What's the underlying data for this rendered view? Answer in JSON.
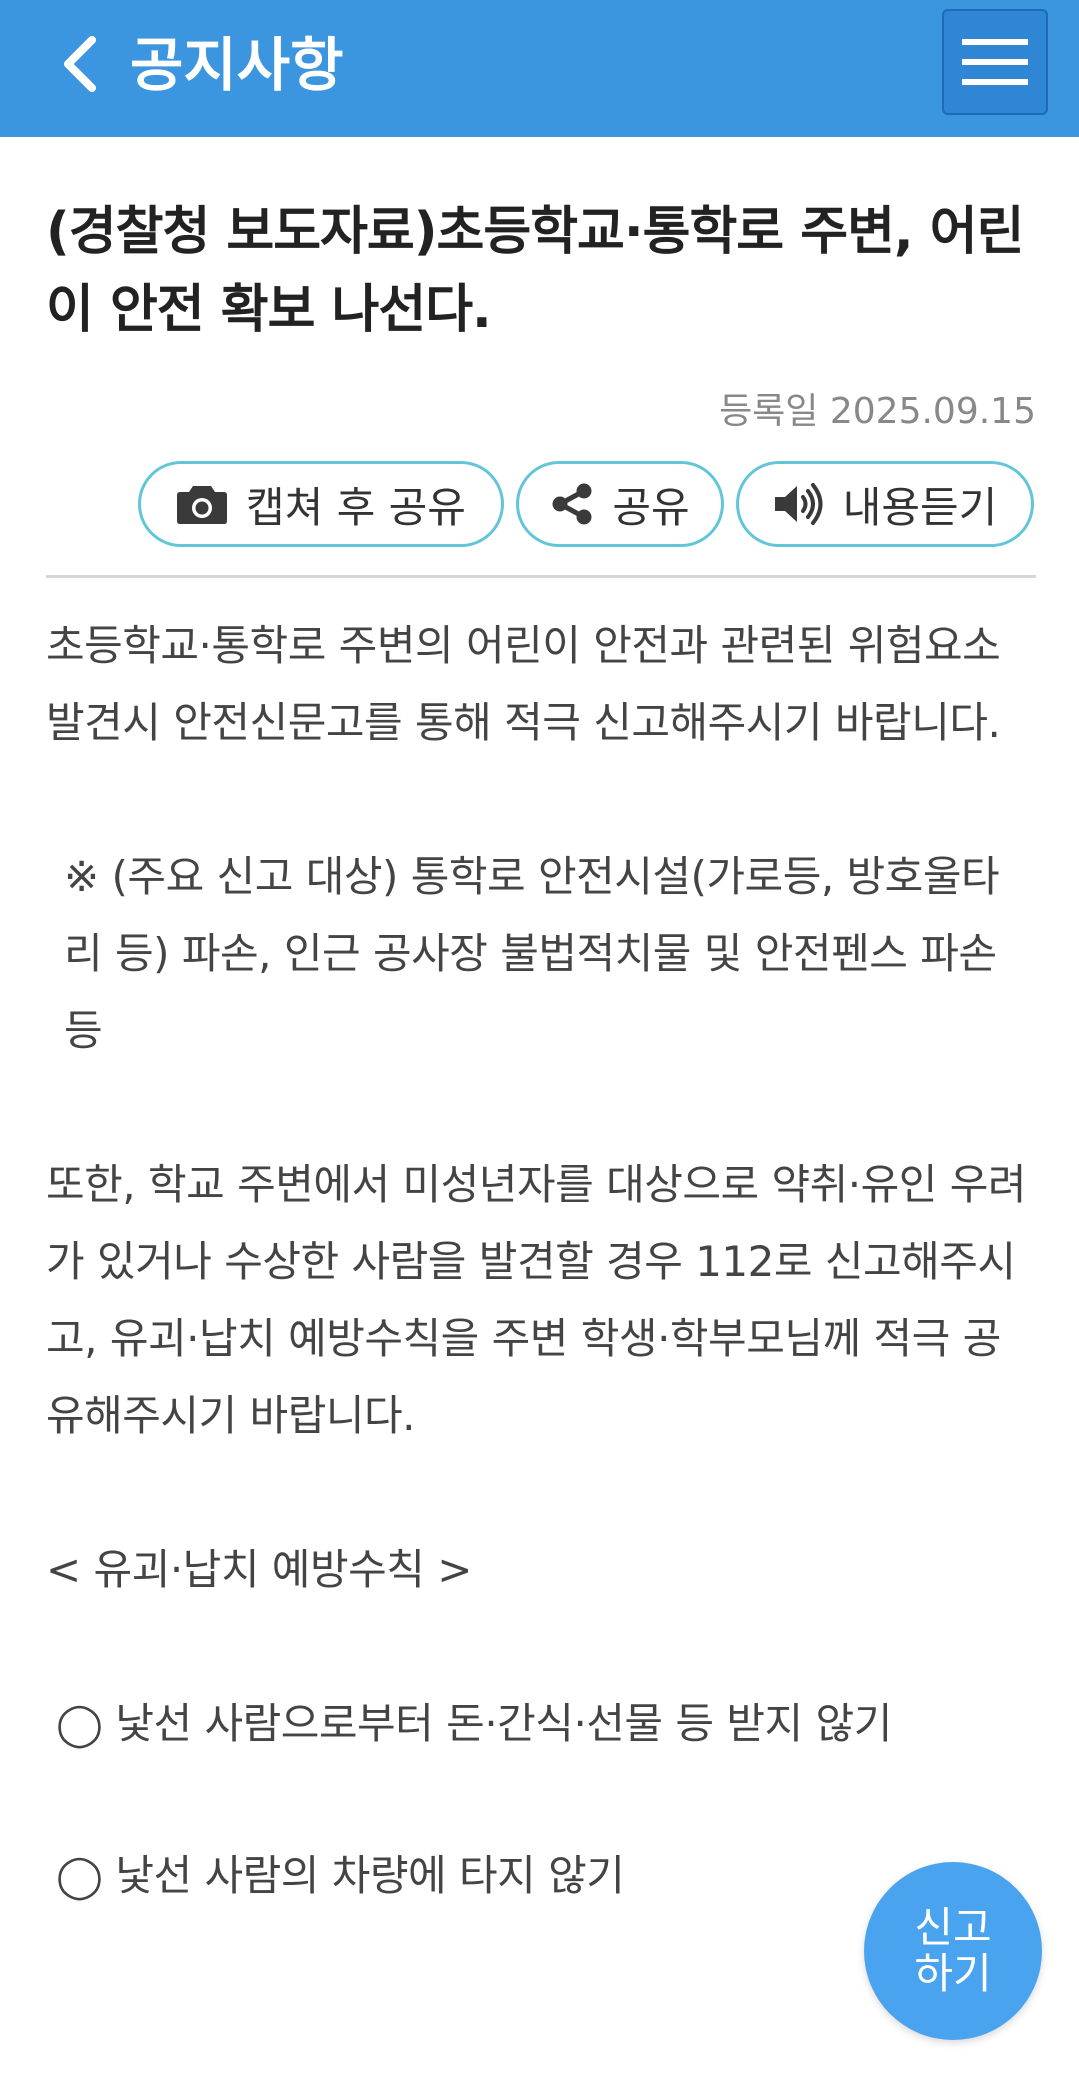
{
  "colors": {
    "primary": "#3b95df",
    "accent_outline": "#63c5d9",
    "fab": "#4aa3ee"
  },
  "header": {
    "title": "공지사항",
    "back_icon": "chevron-left-icon",
    "menu_icon": "hamburger-menu-icon"
  },
  "article": {
    "title": "(경찰청 보도자료)초등학교·통학로 주변, 어린이 안전 확보 나선다.",
    "date": "등록일 2025.09.15",
    "actions": {
      "capture_share": "캡쳐 후 공유",
      "share": "공유",
      "listen": "내용듣기"
    },
    "paragraphs": [
      "초등학교·통학로 주변의 어린이 안전과 관련된 위험요소 발견시 안전신문고를 통해 적극 신고해주시기 바랍니다.",
      "※ (주요 신고 대상) 통학로 안전시설(가로등, 방호울타리 등) 파손, 인근 공사장 불법적치물 및 안전펜스 파손 등",
      "또한, 학교 주변에서 미성년자를 대상으로 약취·유인 우려가 있거나 수상한 사람을 발견할 경우 112로 신고해주시고, 유괴·납치 예방수칙을 주변 학생·학부모님께 적극 공유해주시기 바랍니다.",
      "< 유괴·납치 예방수칙 >",
      "◯ 낯선 사람으로부터 돈·간식·선물 등 받지 않기",
      "◯ 낯선 사람의 차량에 타지 않기"
    ]
  },
  "fab": {
    "line1": "신고",
    "line2": "하기"
  }
}
